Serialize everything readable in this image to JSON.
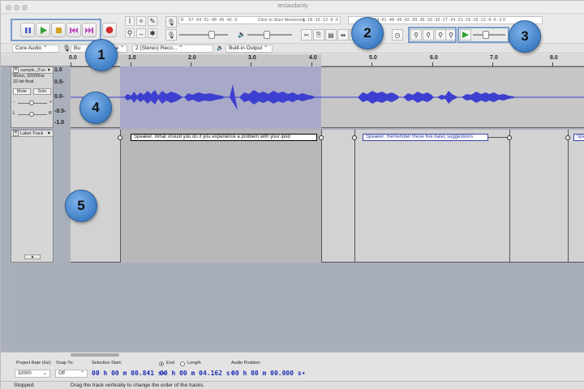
{
  "window": {
    "title": "testaudacity"
  },
  "transport": {
    "pause_icon": "pause-icon",
    "play_icon": "play-icon",
    "stop_icon": "stop-icon",
    "skip_start_icon": "skip-to-start-icon",
    "skip_end_icon": "skip-to-end-icon",
    "record_icon": "record-icon"
  },
  "meters": {
    "record_scale": "-57 -54 -51 -48 -45 -42 -3",
    "record_prompt": "Click to Start Monitoring",
    "record_scale_right": "1 -18 -15 -12 -9 -6 -3 0",
    "playback_scale": "-57 -54 -51 -48 -45 -42 -39 -36 -33 -30 -27 -24 -21 -18 -15 -12 -9 -6 -3 0",
    "record_channel_label": "R",
    "record_channel_label_left": "L"
  },
  "devicebar": {
    "host": "Core Audio",
    "input_device": "Bu",
    "input_device_tail": "ne",
    "channels": "2 (Stereo) Reco...",
    "output_device": "Built-in Output"
  },
  "ruler": {
    "ticks": [
      "0.0",
      "1.0",
      "2.0",
      "3.0",
      "4.0",
      "5.0",
      "6.0",
      "7.0",
      "8.0"
    ]
  },
  "audio_track": {
    "name": "sample_iTun",
    "line1": "Mono, 32000Hz",
    "line2": "32-bit float",
    "mute_label": "Mute",
    "solo_label": "Solo",
    "gain_minus": "-",
    "gain_plus": "+",
    "pan_left": "L",
    "pan_right": "R",
    "scale": [
      "1.0",
      "0.5-",
      "0.0-",
      "-0.5-",
      "-1.0"
    ]
  },
  "label_track": {
    "name": "Label Track",
    "labels": [
      {
        "text": "Speaker: What should you do if you experience a problem with your ipod"
      },
      {
        "text": "Speaker: Remember these five basic suggestions"
      },
      {
        "text": "Spe"
      }
    ]
  },
  "callouts": [
    "1",
    "2",
    "3",
    "4",
    "5"
  ],
  "selection_toolbar": {
    "project_rate_label": "Project Rate (Hz):",
    "project_rate_value": "32000",
    "snap_label": "Snap To:",
    "snap_value": "Off",
    "selection_start_label": "Selection Start:",
    "end_label": "End",
    "length_label": "Length",
    "audio_position_label": "Audio Position:",
    "start_time": "00 h 00 m 00.841 s",
    "end_time": "00 h 00 m 04.162 s",
    "position_time": "00 h 00 m 00.000 s"
  },
  "status": {
    "state": "Stopped.",
    "hint": "Drag the track vertically to change the order of the tracks."
  },
  "colors": {
    "waveform": "#3d3fd0",
    "selection": "#a8a8c9",
    "callout": "#3f7fc6",
    "time_text": "#1f2fb5"
  }
}
